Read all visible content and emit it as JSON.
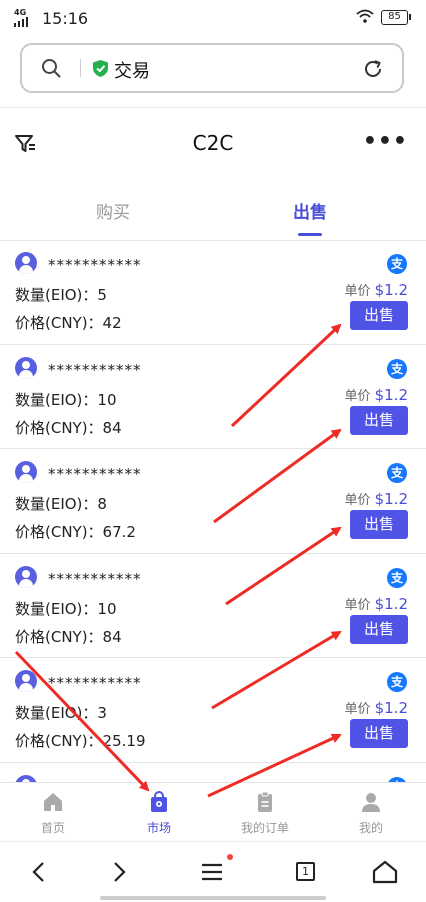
{
  "status_bar": {
    "network": "4G",
    "time": "15:16",
    "battery": "85"
  },
  "search": {
    "text": "交易"
  },
  "header": {
    "title": "C2C",
    "more": "•••"
  },
  "tabs": {
    "buy": "购买",
    "sell": "出售"
  },
  "masked_user": "***********",
  "unit_label": "单价",
  "sell_label": "出售",
  "orders": [
    {
      "qty": "数量(EIO)：5",
      "price": "价格(CNY)：42",
      "unit_price": "$1.2"
    },
    {
      "qty": "数量(EIO)：10",
      "price": "价格(CNY)：84",
      "unit_price": "$1.2"
    },
    {
      "qty": "数量(EIO)：8",
      "price": "价格(CNY)：67.2",
      "unit_price": "$1.2"
    },
    {
      "qty": "数量(EIO)：10",
      "price": "价格(CNY)：84",
      "unit_price": "$1.2"
    },
    {
      "qty": "数量(EIO)：3",
      "price": "价格(CNY)：25.19",
      "unit_price": "$1.2"
    }
  ],
  "bottom_nav": {
    "home": "首页",
    "market": "市场",
    "orders": "我的订单",
    "mine": "我的"
  },
  "browser": {
    "tabs_count": "1"
  },
  "colors": {
    "accent": "#5054e6",
    "alipay": "#1677ff",
    "arrow": "#ee2b24"
  }
}
